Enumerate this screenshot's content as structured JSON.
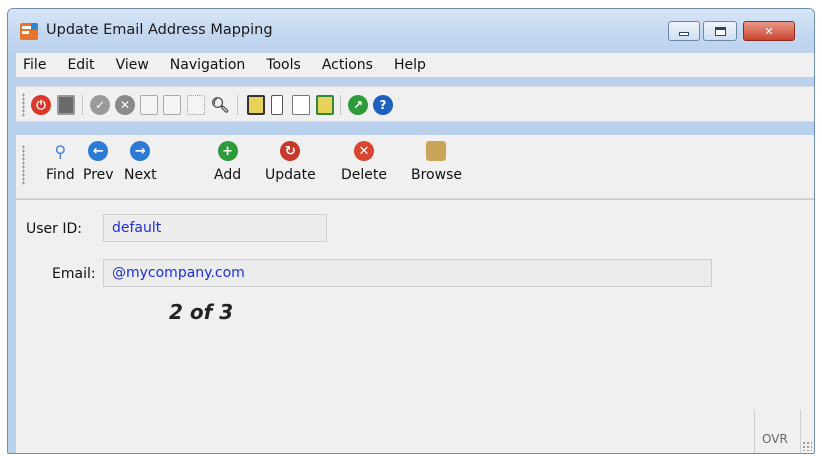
{
  "window": {
    "title": "Update Email Address Mapping"
  },
  "menu": [
    "File",
    "Edit",
    "View",
    "Navigation",
    "Tools",
    "Actions",
    "Help"
  ],
  "toolbar_icons": [
    "power-icon",
    "screens-icon",
    "check-icon",
    "cancel-icon",
    "doc-icon",
    "docs-icon",
    "list-icon",
    "zoom-icon",
    "clipboard-icon",
    "attach-icon",
    "report-icon",
    "task-icon",
    "chart-icon",
    "help-icon"
  ],
  "nav_buttons": [
    {
      "label": "Find",
      "icon": "search-icon",
      "color": "#3f7fcf"
    },
    {
      "label": "Prev",
      "icon": "arrow-left-icon",
      "color": "#2a7ad6"
    },
    {
      "label": "Next",
      "icon": "arrow-right-icon",
      "color": "#2a7ad6"
    },
    {
      "label": "Add",
      "icon": "plus-icon",
      "color": "#2f9a3a"
    },
    {
      "label": "Update",
      "icon": "refresh-icon",
      "color": "#c6392b"
    },
    {
      "label": "Delete",
      "icon": "delete-icon",
      "color": "#d9452f"
    },
    {
      "label": "Browse",
      "icon": "folder-icon",
      "color": "#c9a55a"
    }
  ],
  "form": {
    "user_id_label": "User ID:",
    "user_id_value": "default",
    "email_label": "Email:",
    "email_value": "@mycompany.com"
  },
  "record_counter": "2 of 3",
  "status": {
    "mode": "OVR"
  }
}
